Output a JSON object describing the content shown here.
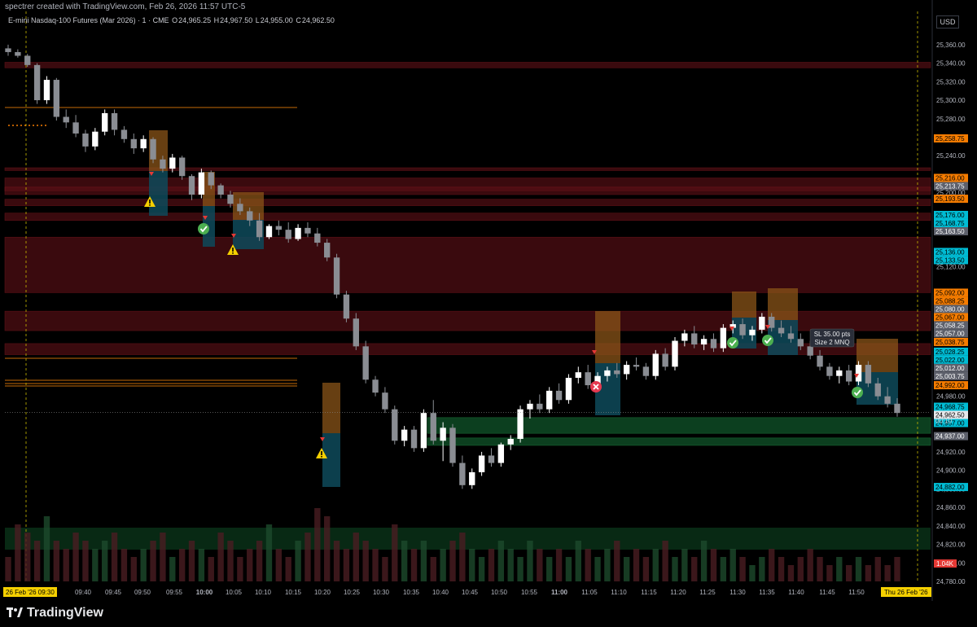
{
  "credit": "spectrer created with TradingView.com, Feb 26, 2026 11:57 UTC-5",
  "symbol": {
    "title": "E-mini Nasdaq-100 Futures (Mar 2026) · 1 · CME",
    "o_label": "O",
    "o": "24,965.25",
    "h_label": "H",
    "h": "24,967.50",
    "l_label": "L",
    "l": "24,955.00",
    "c_label": "C",
    "c": "24,962.50"
  },
  "currency": "USD",
  "brand": "TradingView",
  "colors": {
    "up_candle": "#ffffff",
    "down_candle": "#8a8d93",
    "resistance_zone": "#5a1016",
    "support_zone": "#0f4a25",
    "entry_zone": "#8a5418",
    "target_zone": "#0e4a5a",
    "orange_label": "#f57c00",
    "teal_label": "#00bcd4",
    "gray_label": "#5d606b",
    "red_label": "#e53935",
    "yellow_label": "#f5d000"
  },
  "chart_data": {
    "type": "candlestick",
    "instrument": "E-mini Nasdaq-100 Futures (Mar 2026)",
    "interval": "1",
    "ylim": [
      24780,
      25370
    ],
    "y_ticks": [
      25360,
      25340,
      25320,
      25300,
      25280,
      25240,
      25200,
      25120,
      24980,
      24920,
      24900,
      24880,
      24860,
      24840,
      24820,
      24800,
      24780
    ],
    "y_tick_labels": [
      "25,360.00",
      "25,340.00",
      "25,320.00",
      "25,300.00",
      "25,280.00",
      "25,240.00",
      "25,200.00",
      "25,120.00",
      "24,980.00",
      "24,920.00",
      "24,900.00",
      "24,880.00",
      "24,860.00",
      "24,840.00",
      "24,820.00",
      "24,800.00",
      "24,780.00"
    ],
    "x_ticks": [
      "09:40",
      "09:45",
      "09:50",
      "09:55",
      "10:00",
      "10:05",
      "10:10",
      "10:15",
      "10:20",
      "10:25",
      "10:30",
      "10:35",
      "10:40",
      "10:45",
      "10:50",
      "10:55",
      "11:00",
      "11:05",
      "11:10",
      "11:15",
      "11:20",
      "11:25",
      "11:30",
      "11:35",
      "11:40",
      "11:45",
      "11:50"
    ],
    "x_tick_bold": [
      "10:00",
      "11:00"
    ],
    "x_start_label": "26 Feb '26  09:30",
    "x_end_label": "Thu 26 Feb '26",
    "price_tags": [
      {
        "text": "25,258.75",
        "value": 25258.75,
        "kind": "orange"
      },
      {
        "text": "25,216.00",
        "value": 25216.0,
        "kind": "orange"
      },
      {
        "text": "25,213.75",
        "value": 25213.75,
        "kind": "gray"
      },
      {
        "text": "25,193.50",
        "value": 25193.5,
        "kind": "orange"
      },
      {
        "text": "25,176.00",
        "value": 25176.0,
        "kind": "teal"
      },
      {
        "text": "25,168.75",
        "value": 25168.75,
        "kind": "teal"
      },
      {
        "text": "25,163.50",
        "value": 25163.5,
        "kind": "gray"
      },
      {
        "text": "25,136.00",
        "value": 25136.0,
        "kind": "teal"
      },
      {
        "text": "25,133.50",
        "value": 25133.5,
        "kind": "teal"
      },
      {
        "text": "25,092.00",
        "value": 25092.0,
        "kind": "orange"
      },
      {
        "text": "25,088.25",
        "value": 25088.25,
        "kind": "orange"
      },
      {
        "text": "25,080.00",
        "value": 25080.0,
        "kind": "gray"
      },
      {
        "text": "25,067.00",
        "value": 25067.0,
        "kind": "orange"
      },
      {
        "text": "25,058.25",
        "value": 25058.25,
        "kind": "gray"
      },
      {
        "text": "25,057.00",
        "value": 25057.0,
        "kind": "gray"
      },
      {
        "text": "25,038.75",
        "value": 25038.75,
        "kind": "orange"
      },
      {
        "text": "25,028.25",
        "value": 25028.25,
        "kind": "teal"
      },
      {
        "text": "25,022.00",
        "value": 25022.0,
        "kind": "teal"
      },
      {
        "text": "25,012.00",
        "value": 25012.0,
        "kind": "gray"
      },
      {
        "text": "25,003.75",
        "value": 25003.75,
        "kind": "gray"
      },
      {
        "text": "24,992.00",
        "value": 24992.0,
        "kind": "orange"
      },
      {
        "text": "24,968.75",
        "value": 24968.75,
        "kind": "teal"
      },
      {
        "text": "24,962.50",
        "value": 24962.5,
        "kind": "white"
      },
      {
        "text": "24,957.00",
        "value": 24957.0,
        "kind": "teal"
      },
      {
        "text": "24,937.00",
        "value": 24937.0,
        "kind": "gray"
      },
      {
        "text": "24,882.00",
        "value": 24882.0,
        "kind": "teal"
      }
    ],
    "countdown": "00:10",
    "volume_tag": "1.04K",
    "position_note": {
      "line1": "SL 35.00 pts",
      "line2": "Size 2 MNQ"
    },
    "resistance_zones": [
      [
        25341,
        25335
      ],
      [
        25227,
        25224
      ],
      [
        25216,
        25202
      ],
      [
        25206,
        25198
      ],
      [
        25193,
        25186
      ],
      [
        25178,
        25170
      ],
      [
        25152,
        25092
      ],
      [
        25072,
        25051
      ],
      [
        25037,
        25025
      ]
    ],
    "support_zones": [
      [
        24957,
        24940
      ],
      [
        24935,
        24927
      ]
    ],
    "candles": [
      [
        25356,
        25360,
        25348,
        25352
      ],
      [
        25352,
        25355,
        25346,
        25348
      ],
      [
        25348,
        25350,
        25336,
        25338
      ],
      [
        25338,
        25340,
        25296,
        25300
      ],
      [
        25300,
        25326,
        25296,
        25322
      ],
      [
        25322,
        25324,
        25278,
        25282
      ],
      [
        25282,
        25290,
        25270,
        25276
      ],
      [
        25276,
        25284,
        25260,
        25264
      ],
      [
        25264,
        25268,
        25244,
        25250
      ],
      [
        25250,
        25270,
        25246,
        25266
      ],
      [
        25266,
        25290,
        25262,
        25286
      ],
      [
        25286,
        25290,
        25262,
        25268
      ],
      [
        25268,
        25272,
        25254,
        25258
      ],
      [
        25258,
        25264,
        25242,
        25248
      ],
      [
        25248,
        25262,
        25244,
        25258
      ],
      [
        25258,
        25260,
        25232,
        25236
      ],
      [
        25236,
        25240,
        25222,
        25226
      ],
      [
        25226,
        25242,
        25222,
        25238
      ],
      [
        25238,
        25240,
        25214,
        25218
      ],
      [
        25218,
        25220,
        25192,
        25198
      ],
      [
        25198,
        25226,
        25194,
        25222
      ],
      [
        25222,
        25224,
        25204,
        25208
      ],
      [
        25208,
        25210,
        25194,
        25198
      ],
      [
        25198,
        25202,
        25184,
        25188
      ],
      [
        25188,
        25194,
        25176,
        25180
      ],
      [
        25180,
        25184,
        25164,
        25170
      ],
      [
        25170,
        25178,
        25148,
        25152
      ],
      [
        25152,
        25166,
        25150,
        25164
      ],
      [
        25164,
        25170,
        25154,
        25160
      ],
      [
        25160,
        25168,
        25146,
        25150
      ],
      [
        25150,
        25166,
        25148,
        25162
      ],
      [
        25162,
        25168,
        25152,
        25156
      ],
      [
        25156,
        25162,
        25142,
        25146
      ],
      [
        25146,
        25150,
        25126,
        25130
      ],
      [
        25130,
        25134,
        25086,
        25090
      ],
      [
        25090,
        25094,
        25060,
        25064
      ],
      [
        25064,
        25070,
        25030,
        25034
      ],
      [
        25034,
        25040,
        24994,
        24998
      ],
      [
        24998,
        25002,
        24980,
        24984
      ],
      [
        24984,
        24990,
        24962,
        24966
      ],
      [
        24966,
        24970,
        24928,
        24932
      ],
      [
        24932,
        24948,
        24926,
        24944
      ],
      [
        24944,
        24948,
        24920,
        24924
      ],
      [
        24924,
        24966,
        24920,
        24962
      ],
      [
        24962,
        24976,
        24928,
        24932
      ],
      [
        24932,
        24952,
        24910,
        24946
      ],
      [
        24946,
        24950,
        24904,
        24908
      ],
      [
        24908,
        24916,
        24880,
        24884
      ],
      [
        24884,
        24902,
        24880,
        24898
      ],
      [
        24898,
        24920,
        24894,
        24916
      ],
      [
        24916,
        24924,
        24904,
        24908
      ],
      [
        24908,
        24930,
        24904,
        24928
      ],
      [
        24928,
        24938,
        24922,
        24934
      ],
      [
        24934,
        24970,
        24930,
        24966
      ],
      [
        24966,
        24976,
        24956,
        24972
      ],
      [
        24972,
        24982,
        24962,
        24966
      ],
      [
        24966,
        24990,
        24962,
        24986
      ],
      [
        24986,
        24994,
        24972,
        24976
      ],
      [
        24976,
        25004,
        24972,
        25000
      ],
      [
        25000,
        25012,
        24994,
        25006
      ],
      [
        25006,
        25014,
        24988,
        24992
      ],
      [
        24992,
        25006,
        24986,
        25002
      ],
      [
        25002,
        25012,
        24996,
        25008
      ],
      [
        25008,
        25016,
        25000,
        25004
      ],
      [
        25004,
        25018,
        24998,
        25014
      ],
      [
        25014,
        25022,
        25008,
        25012
      ],
      [
        25012,
        25016,
        24998,
        25002
      ],
      [
        25002,
        25030,
        24998,
        25026
      ],
      [
        25026,
        25032,
        25008,
        25012
      ],
      [
        25012,
        25044,
        25008,
        25040
      ],
      [
        25040,
        25052,
        25034,
        25048
      ],
      [
        25048,
        25056,
        25032,
        25036
      ],
      [
        25036,
        25046,
        25030,
        25042
      ],
      [
        25042,
        25048,
        25028,
        25032
      ],
      [
        25032,
        25058,
        25028,
        25054
      ],
      [
        25054,
        25062,
        25048,
        25058
      ],
      [
        25058,
        25064,
        25042,
        25046
      ],
      [
        25046,
        25056,
        25040,
        25052
      ],
      [
        25052,
        25070,
        25048,
        25066
      ],
      [
        25066,
        25070,
        25050,
        25054
      ],
      [
        25054,
        25062,
        25044,
        25048
      ],
      [
        25048,
        25056,
        25038,
        25042
      ],
      [
        25042,
        25048,
        25030,
        25034
      ],
      [
        25034,
        25040,
        25020,
        25024
      ],
      [
        25024,
        25030,
        25008,
        25012
      ],
      [
        25012,
        25016,
        24998,
        25002
      ],
      [
        25002,
        25012,
        24994,
        25008
      ],
      [
        25008,
        25014,
        24992,
        24996
      ],
      [
        24996,
        25018,
        24992,
        25014
      ],
      [
        25014,
        25018,
        24990,
        24994
      ],
      [
        24994,
        25000,
        24976,
        24980
      ],
      [
        24980,
        24990,
        24968,
        24972
      ],
      [
        24972,
        24978,
        24958,
        24962
      ]
    ],
    "volume": [
      3,
      7,
      6,
      5,
      8,
      5,
      4,
      6,
      5,
      4,
      5,
      6,
      4,
      3,
      4,
      5,
      6,
      3,
      4,
      5,
      4,
      3,
      6,
      5,
      3,
      4,
      5,
      7,
      4,
      3,
      5,
      6,
      9,
      8,
      5,
      4,
      6,
      5,
      4,
      3,
      7,
      5,
      4,
      5,
      3,
      4,
      5,
      6,
      4,
      3,
      4,
      5,
      4,
      3,
      5,
      4,
      3,
      4,
      3,
      5,
      4,
      3,
      4,
      5,
      3,
      4,
      3,
      4,
      5,
      3,
      4,
      3,
      5,
      4,
      3,
      4,
      3,
      2,
      3,
      4,
      3,
      2,
      3,
      4,
      3,
      2,
      3,
      2,
      3,
      2,
      3,
      2,
      3
    ]
  }
}
